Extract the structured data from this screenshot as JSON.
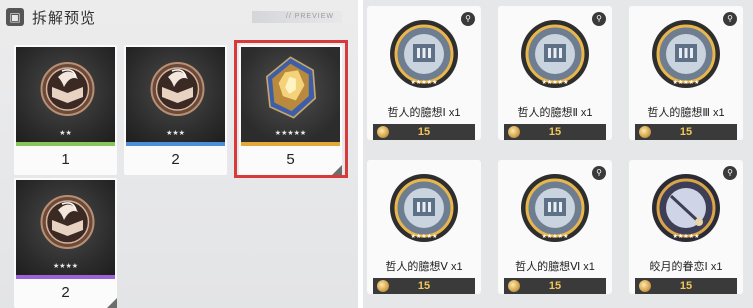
{
  "left_panel": {
    "header_icon": "box-icon",
    "title": "拆解预览",
    "tag": "// PREVIEW",
    "cards": [
      {
        "stars": "★★",
        "count": "1",
        "rarity_color": "#8ac55a",
        "kind": "badge"
      },
      {
        "stars": "★★★",
        "count": "2",
        "rarity_color": "#4b8fd6",
        "kind": "badge"
      },
      {
        "stars": "★★★★★",
        "count": "5",
        "rarity_color": "#e0a93a",
        "kind": "crystal"
      },
      {
        "stars": "★★★★",
        "count": "2",
        "rarity_color": "#9a63d6",
        "kind": "badge"
      }
    ]
  },
  "right_panel": {
    "items": [
      {
        "name": "哲人的臆想Ⅰ x1",
        "price": "15",
        "kind": "reader"
      },
      {
        "name": "哲人的臆想Ⅱ x1",
        "price": "15",
        "kind": "reader"
      },
      {
        "name": "哲人的臆想Ⅲ x1",
        "price": "15",
        "kind": "reader"
      },
      {
        "name": "哲人的臆想Ⅴ x1",
        "price": "15",
        "kind": "reader"
      },
      {
        "name": "哲人的臆想Ⅵ x1",
        "price": "15",
        "kind": "reader"
      },
      {
        "name": "皎月的眷恋Ⅰ x1",
        "price": "15",
        "kind": "moon"
      }
    ],
    "item_stars": "★★★★★",
    "magnify_icon": "magnifier-icon",
    "coin_icon": "coin-icon"
  }
}
